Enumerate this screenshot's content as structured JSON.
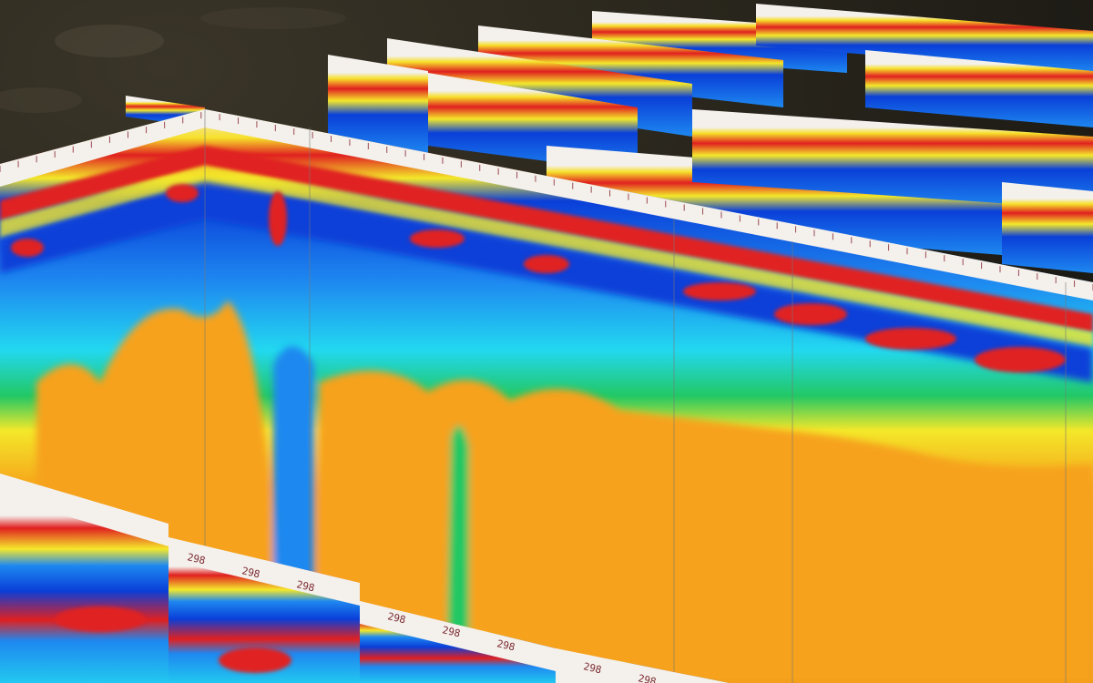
{
  "scene": {
    "colormap": {
      "deep": "#0a3fd8",
      "blue": "#1e88f0",
      "cyan": "#22d8f0",
      "green": "#22c864",
      "yellow": "#f4e82a",
      "orange": "#f6a21a",
      "red": "#e02020",
      "header": "#f4f0ec"
    },
    "ground_color": "#2b2820",
    "front_labels": [
      "298",
      "298",
      "298",
      "298",
      "298",
      "298",
      "298",
      "298"
    ]
  }
}
